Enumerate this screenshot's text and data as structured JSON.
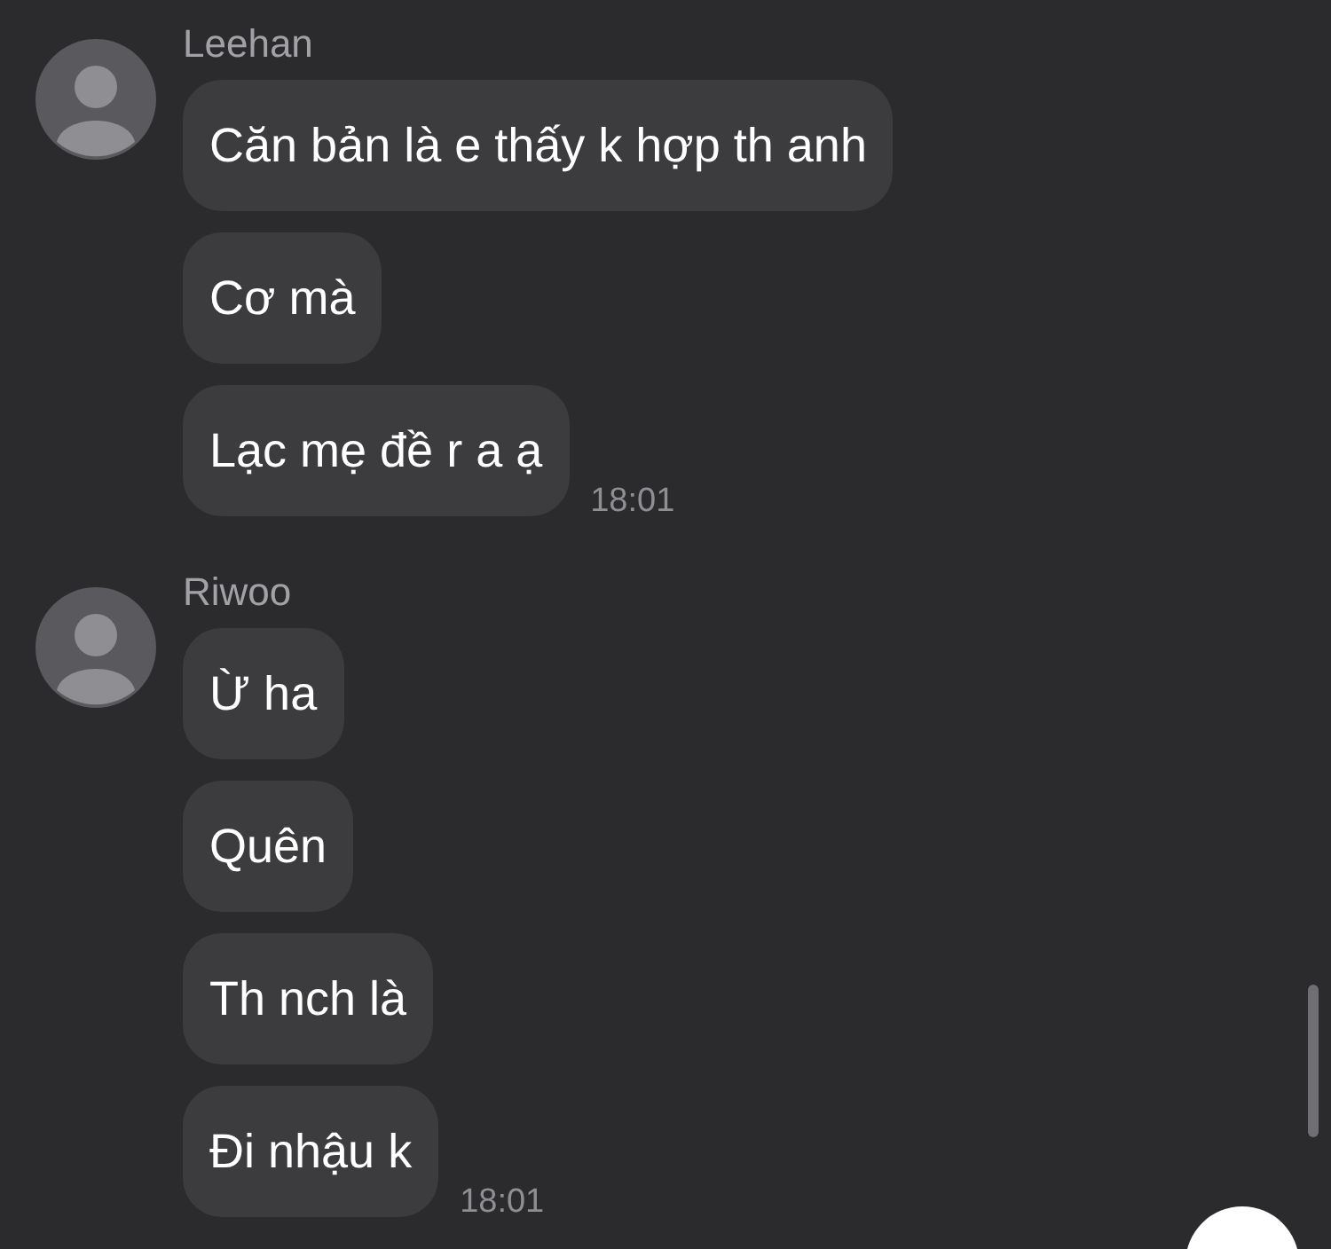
{
  "groups": [
    {
      "sender": "Leehan",
      "messages": [
        "Căn bản là e thấy k hợp th anh",
        "Cơ mà",
        "Lạc mẹ đề r a ạ"
      ],
      "time": "18:01"
    },
    {
      "sender": "Riwoo",
      "messages": [
        "Ừ ha",
        "Quên",
        "Th nch là",
        "Đi nhậu k"
      ],
      "time": "18:01"
    }
  ]
}
